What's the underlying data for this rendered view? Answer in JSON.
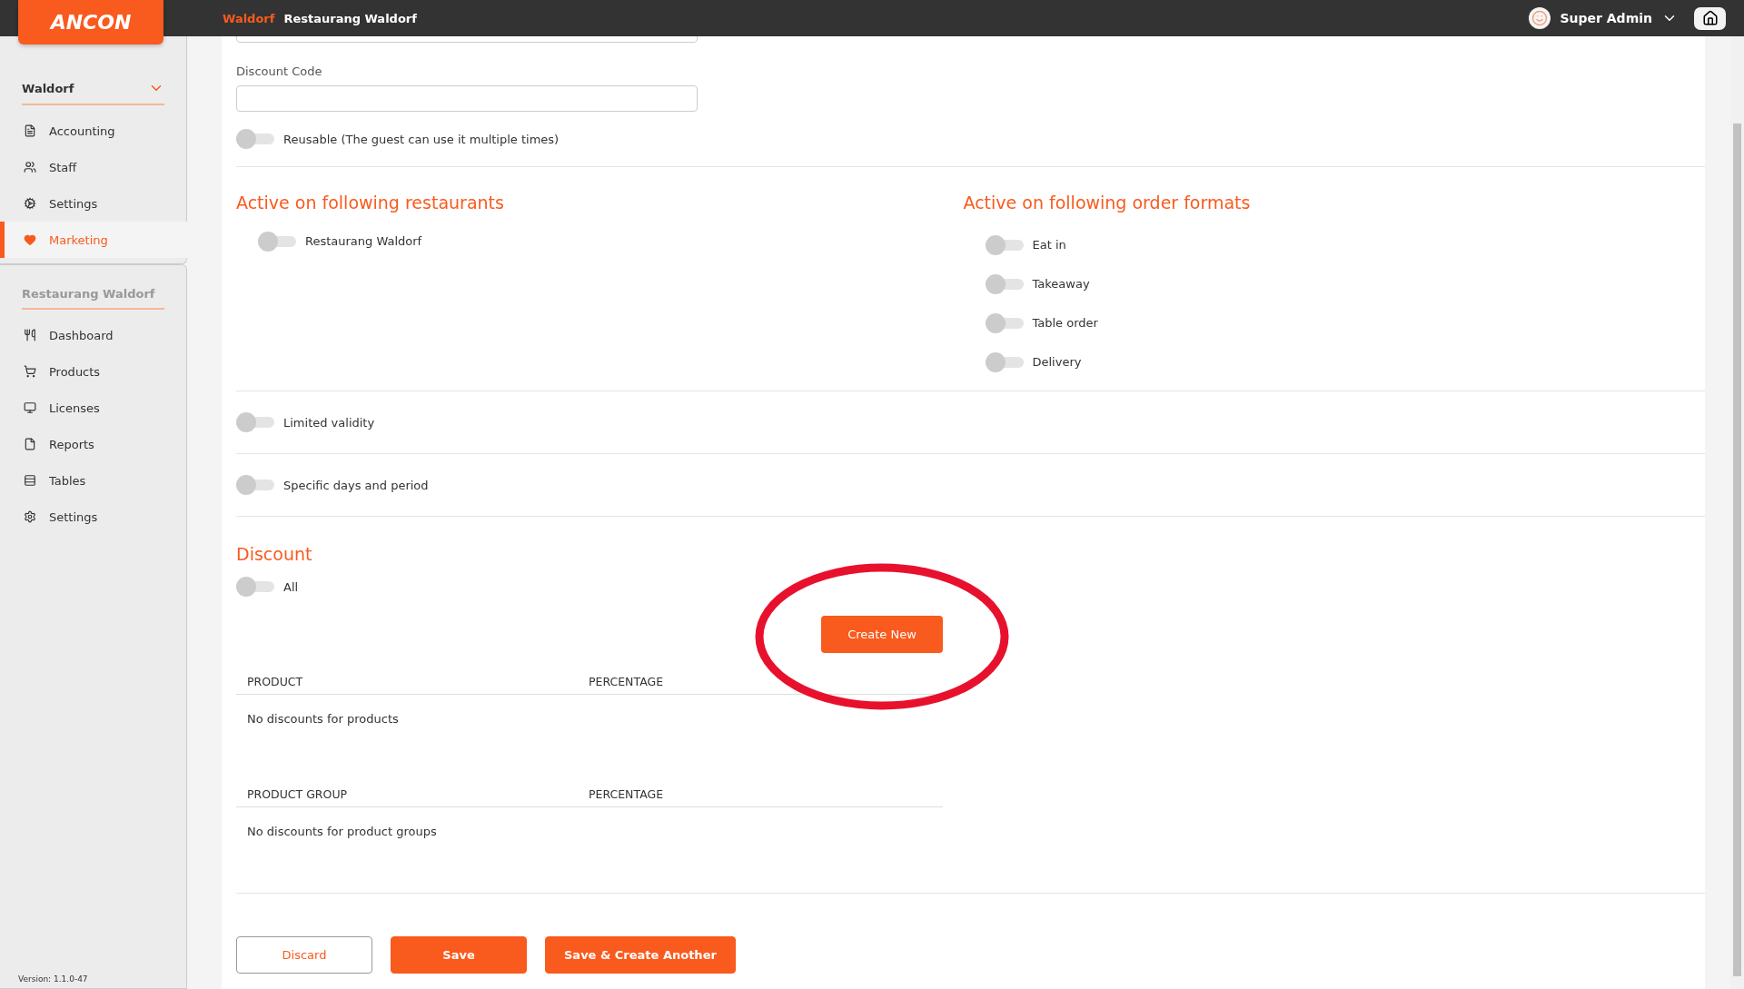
{
  "topbar": {
    "logo": "ANCON",
    "breadcrumb": [
      {
        "label": "Waldorf",
        "kind": "parent"
      },
      {
        "label": "Restaurang Waldorf",
        "kind": "current"
      }
    ],
    "user": "Super Admin"
  },
  "sidebar": {
    "org": {
      "name": "Waldorf",
      "expanded": true,
      "items": [
        {
          "label": "Accounting",
          "selected": false
        },
        {
          "label": "Staff",
          "selected": false
        },
        {
          "label": "Settings",
          "selected": false
        },
        {
          "label": "Marketing",
          "selected": true
        }
      ]
    },
    "restaurant": {
      "title": "Restaurang Waldorf",
      "items": [
        {
          "label": "Dashboard",
          "selected": false
        },
        {
          "label": "Products",
          "selected": false
        },
        {
          "label": "Licenses",
          "selected": false
        },
        {
          "label": "Reports",
          "selected": false
        },
        {
          "label": "Tables",
          "selected": false
        },
        {
          "label": "Settings",
          "selected": false
        }
      ]
    },
    "version": "Version: 1.1.0-47"
  },
  "form": {
    "discount_code": {
      "label": "Discount Code"
    },
    "reusable": {
      "label": "Reusable (The guest can use it multiple times)",
      "on": false
    },
    "restaurants": {
      "title": "Active on following restaurants",
      "items": [
        {
          "label": "Restaurang Waldorf",
          "on": false
        }
      ]
    },
    "order_formats": {
      "title": "Active on following order formats",
      "items": [
        {
          "label": "Eat in",
          "on": false
        },
        {
          "label": "Takeaway",
          "on": false
        },
        {
          "label": "Table order",
          "on": false
        },
        {
          "label": "Delivery",
          "on": false
        }
      ]
    },
    "limited_validity": {
      "label": "Limited validity",
      "on": false
    },
    "specific_days": {
      "label": "Specific days and period",
      "on": false
    },
    "discount": {
      "title": "Discount",
      "all": {
        "label": "All",
        "on": false
      },
      "create_button": "Create New",
      "tables": [
        {
          "columns": [
            "PRODUCT",
            "PERCENTAGE"
          ],
          "empty": "No discounts for products"
        },
        {
          "columns": [
            "PRODUCT GROUP",
            "PERCENTAGE"
          ],
          "empty": "No discounts for product groups"
        }
      ]
    },
    "buttons": [
      {
        "label": "Discard",
        "kind": "outline"
      },
      {
        "label": "Save",
        "kind": "primary"
      },
      {
        "label": "Save & Create Another",
        "kind": "primary"
      }
    ]
  }
}
